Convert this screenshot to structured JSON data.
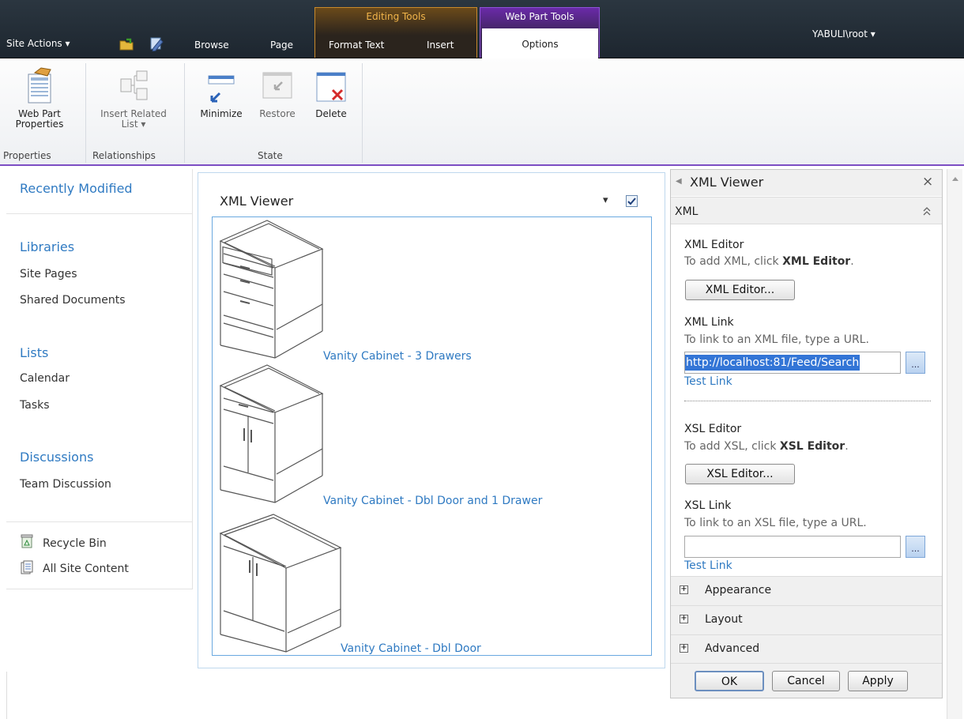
{
  "topbar": {
    "site_actions": "Site Actions ▾",
    "tabs": [
      "Browse",
      "Page",
      "Format Text",
      "Insert",
      "Options"
    ],
    "editing_tools": "Editing Tools",
    "web_part_tools": "Web Part Tools",
    "user": "YABULI\\root ▾"
  },
  "ribbon": {
    "buttons": {
      "web_part_properties": [
        "Web Part",
        "Properties"
      ],
      "insert_related_list": [
        "Insert Related",
        "List ▾"
      ],
      "minimize": "Minimize",
      "restore": "Restore",
      "delete": "Delete"
    },
    "groups": [
      "Properties",
      "Relationships",
      "State"
    ]
  },
  "leftnav": {
    "recently_modified": "Recently Modified",
    "libraries": "Libraries",
    "site_pages": "Site Pages",
    "shared_documents": "Shared Documents",
    "lists": "Lists",
    "calendar": "Calendar",
    "tasks": "Tasks",
    "discussions": "Discussions",
    "team_discussion": "Team Discussion",
    "recycle_bin": "Recycle Bin",
    "all_site_content": "All Site Content"
  },
  "webpart": {
    "title": "XML Viewer",
    "menu_arrow": "▾",
    "items": [
      "Vanity Cabinet - 3 Drawers",
      "Vanity Cabinet - Dbl Door and 1 Drawer",
      "Vanity Cabinet - Dbl Door"
    ]
  },
  "toolpane": {
    "title": "XML Viewer",
    "section": "XML",
    "xml_editor_label": "XML Editor",
    "xml_editor_hint_pre": "To add XML, click ",
    "xml_editor_hint_bold": "XML Editor",
    "xml_editor_btn": "XML Editor...",
    "xml_link_label": "XML Link",
    "xml_link_hint": "To link to an XML file, type a URL.",
    "xml_link_value": "http://localhost:81/Feed/Search",
    "test_link": "Test Link",
    "xsl_editor_label": "XSL Editor",
    "xsl_editor_hint_pre": "To add XSL, click ",
    "xsl_editor_hint_bold": "XSL Editor",
    "xsl_editor_btn": "XSL Editor...",
    "xsl_link_label": "XSL Link",
    "xsl_link_hint": "To link to an XSL file, type a URL.",
    "xsl_link_value": "",
    "ellipsis": "...",
    "accordions": [
      "Appearance",
      "Layout",
      "Advanced"
    ],
    "ok": "OK",
    "cancel": "Cancel",
    "apply": "Apply"
  }
}
